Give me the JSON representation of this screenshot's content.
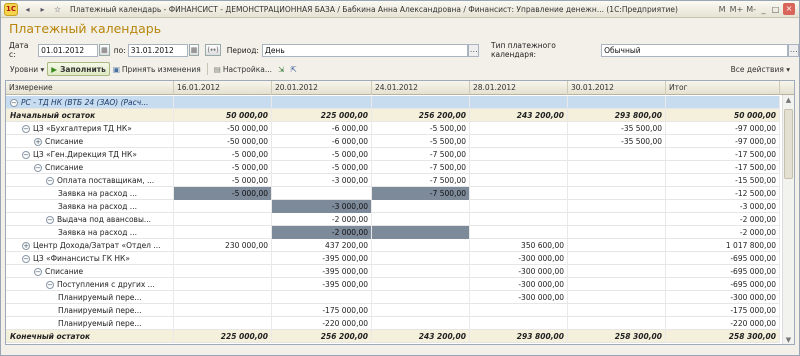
{
  "titlebar": {
    "title": "Платежный календарь - ФИНАНСИСТ - ДЕМОНСТРАЦИОННАЯ БАЗА / Бабкина Анна Александровна / Финансист: Управление денежн... (1С:Предприятие)",
    "m": "M",
    "mplus": "M+",
    "mminus": "M-",
    "min": "_",
    "max": "□",
    "close": "×"
  },
  "page_title": "Платежный календарь",
  "params": {
    "date_from_label": "Дата с:",
    "date_from": "01.01.2012",
    "date_to_label": "по:",
    "date_to": "31.01.2012",
    "period_label": "Период:",
    "period_value": "День",
    "calendar_type_label": "Тип платежного календаря:",
    "calendar_type_value": "Обычный",
    "shift_button": "(↔)"
  },
  "toolbar": {
    "levels": "Уровни ▾",
    "fill": "Заполнить",
    "accept": "Принять изменения",
    "settings": "Настройка...",
    "all_actions": "Все действия ▾"
  },
  "grid": {
    "columns": [
      "Измерение",
      "16.01.2012",
      "20.01.2012",
      "24.01.2012",
      "28.01.2012",
      "30.01.2012",
      "Итог"
    ],
    "rows": [
      {
        "name": "РС - ТД НК (ВТБ 24 (ЗАО) (Расч...",
        "v": [
          "",
          "",
          "",
          "",
          "",
          ""
        ],
        "style": "hl",
        "indent": 0,
        "exp": "-"
      },
      {
        "name": "Начальный остаток",
        "v": [
          "50 000,00",
          "225 000,00",
          "256 200,00",
          "243 200,00",
          "293 800,00",
          "50 000,00"
        ],
        "style": "bold",
        "indent": 0,
        "exp": ""
      },
      {
        "name": "ЦЗ «Бухгалтерия ТД НК»",
        "v": [
          "-50 000,00",
          "-6 000,00",
          "-5 500,00",
          "",
          "-35 500,00",
          "-97 000,00"
        ],
        "style": "",
        "indent": 1,
        "exp": "-"
      },
      {
        "name": "Списание",
        "v": [
          "-50 000,00",
          "-6 000,00",
          "-5 500,00",
          "",
          "-35 500,00",
          "-97 000,00"
        ],
        "style": "",
        "indent": 2,
        "exp": "+"
      },
      {
        "name": "ЦЗ «Ген.Дирекция ТД НК»",
        "v": [
          "-5 000,00",
          "-5 000,00",
          "-7 500,00",
          "",
          "",
          "-17 500,00"
        ],
        "style": "",
        "indent": 1,
        "exp": "-"
      },
      {
        "name": "Списание",
        "v": [
          "-5 000,00",
          "-5 000,00",
          "-7 500,00",
          "",
          "",
          "-17 500,00"
        ],
        "style": "",
        "indent": 2,
        "exp": "-"
      },
      {
        "name": "Оплата поставщикам, ...",
        "v": [
          "-5 000,00",
          "-3 000,00",
          "-7 500,00",
          "",
          "",
          "-15 500,00"
        ],
        "style": "",
        "indent": 3,
        "exp": "-"
      },
      {
        "name": "Заявка на расход ...",
        "v": [
          "-5 000,00",
          "",
          "-7 500,00",
          "",
          "",
          "-12 500,00"
        ],
        "style": "",
        "indent": 4,
        "exp": "",
        "grey": [
          0,
          2
        ]
      },
      {
        "name": "Заявка на расход ...",
        "v": [
          "",
          "-3 000,00",
          "",
          "",
          "",
          "-3 000,00"
        ],
        "style": "",
        "indent": 4,
        "exp": "",
        "grey": [
          1
        ]
      },
      {
        "name": "Выдача под авансовы...",
        "v": [
          "",
          "-2 000,00",
          "",
          "",
          "",
          "-2 000,00"
        ],
        "style": "",
        "indent": 3,
        "exp": "-"
      },
      {
        "name": "Заявка на расход ...",
        "v": [
          "",
          "-2 000,00",
          "",
          "",
          "",
          "-2 000,00"
        ],
        "style": "",
        "indent": 4,
        "exp": "",
        "grey": [
          1,
          2
        ]
      },
      {
        "name": "Центр Дохода/Затрат «Отдел ...",
        "v": [
          "230 000,00",
          "437 200,00",
          "",
          "350 600,00",
          "",
          "1 017 800,00"
        ],
        "style": "",
        "indent": 1,
        "exp": "+"
      },
      {
        "name": "ЦЗ «Финансисты ГК НК»",
        "v": [
          "",
          "-395 000,00",
          "",
          "-300 000,00",
          "",
          "-695 000,00"
        ],
        "style": "",
        "indent": 1,
        "exp": "-"
      },
      {
        "name": "Списание",
        "v": [
          "",
          "-395 000,00",
          "",
          "-300 000,00",
          "",
          "-695 000,00"
        ],
        "style": "",
        "indent": 2,
        "exp": "-"
      },
      {
        "name": "Поступления с других ...",
        "v": [
          "",
          "-395 000,00",
          "",
          "-300 000,00",
          "",
          "-695 000,00"
        ],
        "style": "",
        "indent": 3,
        "exp": "-"
      },
      {
        "name": "Планируемый пере...",
        "v": [
          "",
          "",
          "",
          "-300 000,00",
          "",
          "-300 000,00"
        ],
        "style": "",
        "indent": 4,
        "exp": ""
      },
      {
        "name": "Планируемый пере...",
        "v": [
          "",
          "-175 000,00",
          "",
          "",
          "",
          "-175 000,00"
        ],
        "style": "",
        "indent": 4,
        "exp": ""
      },
      {
        "name": "Планируемый пере...",
        "v": [
          "",
          "-220 000,00",
          "",
          "",
          "",
          "-220 000,00"
        ],
        "style": "",
        "indent": 4,
        "exp": ""
      },
      {
        "name": "Конечный остаток",
        "v": [
          "225 000,00",
          "256 200,00",
          "243 200,00",
          "293 800,00",
          "258 300,00",
          "258 300,00"
        ],
        "style": "bold",
        "indent": 0,
        "exp": ""
      }
    ]
  }
}
